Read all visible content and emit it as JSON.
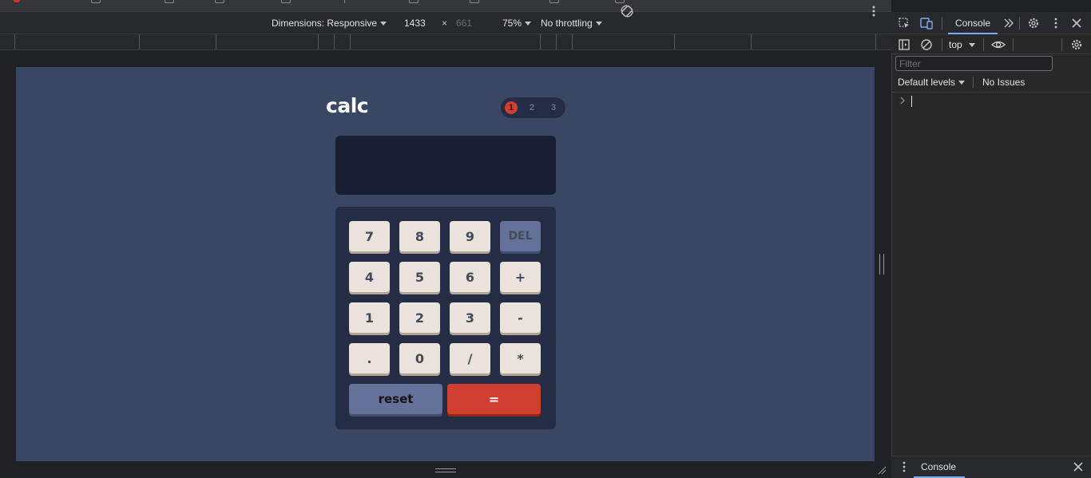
{
  "device_toolbar": {
    "dimensions_label": "Dimensions: Responsive",
    "width": "1433",
    "times": "×",
    "height": "661",
    "zoom": "75%",
    "throttling": "No throttling"
  },
  "calculator": {
    "title": "calc",
    "theme_options": [
      "1",
      "2",
      "3"
    ],
    "selected_theme": "1",
    "screen_value": "",
    "keys": [
      [
        "7",
        "8",
        "9",
        "DEL"
      ],
      [
        "4",
        "5",
        "6",
        "+"
      ],
      [
        "1",
        "2",
        "3",
        "-"
      ],
      [
        ".",
        "0",
        "/",
        "*"
      ]
    ],
    "reset_label": "reset",
    "equals_label": "="
  },
  "devtools": {
    "tab_console": "Console",
    "context": "top",
    "filter_placeholder": "Filter",
    "levels": "Default levels",
    "issues": "No Issues",
    "drawer_tab": "Console"
  },
  "colors": {
    "page_bg": "#3a4764",
    "toggle_bg": "#242d44",
    "screen_bg": "#181f33",
    "key_bg": "#eae3dc",
    "key_text": "#434a59",
    "del_reset_bg": "#647198",
    "accent_red": "#d03f2f"
  }
}
